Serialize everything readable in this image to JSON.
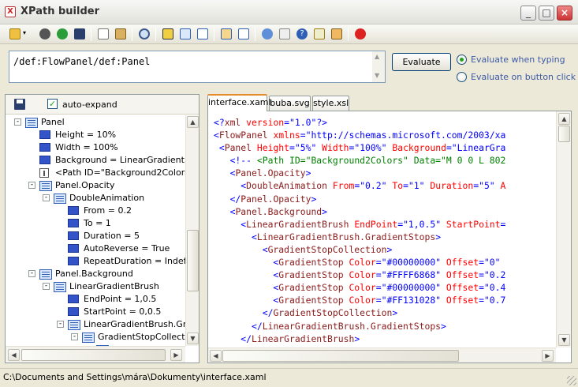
{
  "window": {
    "title": "XPath builder"
  },
  "xpath": {
    "value": "/def:FlowPanel/def:Panel"
  },
  "evaluate": {
    "button_label": "Evaluate",
    "radio_when_typing": "Evaluate when typing",
    "radio_on_button": "Evaluate on button click",
    "selected": "when_typing"
  },
  "tree_panel": {
    "auto_expand_label": "auto-expand",
    "auto_expand_checked": true,
    "nodes": [
      {
        "label": "Panel",
        "type": "element",
        "depth": 1,
        "expander": "-"
      },
      {
        "label": "Height = 10%",
        "type": "attribute",
        "depth": 2
      },
      {
        "label": "Width = 100%",
        "type": "attribute",
        "depth": 2
      },
      {
        "label": "Background = LinearGradient 0,0",
        "type": "attribute",
        "depth": 2
      },
      {
        "label": "<Path ID=\"Background2Colors\" D",
        "type": "comment",
        "depth": 2
      },
      {
        "label": "Panel.Opacity",
        "type": "element",
        "depth": 2,
        "expander": "-"
      },
      {
        "label": "DoubleAnimation",
        "type": "element",
        "depth": 3,
        "expander": "-"
      },
      {
        "label": "From = 0.2",
        "type": "attribute",
        "depth": 4
      },
      {
        "label": "To = 1",
        "type": "attribute",
        "depth": 4
      },
      {
        "label": "Duration = 5",
        "type": "attribute",
        "depth": 4
      },
      {
        "label": "AutoReverse = True",
        "type": "attribute",
        "depth": 4
      },
      {
        "label": "RepeatDuration = Indefinil",
        "type": "attribute",
        "depth": 4
      },
      {
        "label": "Panel.Background",
        "type": "element",
        "depth": 2,
        "expander": "-"
      },
      {
        "label": "LinearGradientBrush",
        "type": "element",
        "depth": 3,
        "expander": "-"
      },
      {
        "label": "EndPoint = 1,0.5",
        "type": "attribute",
        "depth": 4
      },
      {
        "label": "StartPoint = 0,0.5",
        "type": "attribute",
        "depth": 4
      },
      {
        "label": "LinearGradientBrush.Grad",
        "type": "element",
        "depth": 4,
        "expander": "-"
      },
      {
        "label": "GradientStopCollection",
        "type": "element",
        "depth": 5,
        "expander": "-"
      },
      {
        "label": "GradientSto",
        "type": "element",
        "depth": 6,
        "expander": "-"
      }
    ]
  },
  "tabs": [
    {
      "label": "interface.xaml",
      "active": true
    },
    {
      "label": "buba.svg",
      "active": false
    },
    {
      "label": "style.xsl",
      "active": false
    }
  ],
  "code_lines": [
    [
      [
        "br",
        "<?"
      ],
      [
        "el",
        "xml"
      ],
      [
        "at",
        " version"
      ],
      [
        "br",
        "="
      ],
      [
        "val",
        "\"1.0\""
      ],
      [
        "br",
        "?>"
      ]
    ],
    [
      [
        "br",
        "<"
      ],
      [
        "el",
        "FlowPanel"
      ],
      [
        "at",
        " xmlns"
      ],
      [
        "br",
        "="
      ],
      [
        "val",
        "\"http://schemas.microsoft.com/2003/xa"
      ]
    ],
    [
      [
        "br",
        " <"
      ],
      [
        "el",
        "Panel"
      ],
      [
        "at",
        " Height"
      ],
      [
        "br",
        "="
      ],
      [
        "val",
        "\"5%\""
      ],
      [
        "at",
        " Width"
      ],
      [
        "br",
        "="
      ],
      [
        "val",
        "\"100%\""
      ],
      [
        "at",
        " Background"
      ],
      [
        "br",
        "="
      ],
      [
        "val",
        "\"LinearGra"
      ]
    ],
    [
      [
        "br",
        "   <!-- "
      ],
      [
        "com",
        "<Path ID=\"Background2Colors\" Data=\"M 0 0 L 802"
      ]
    ],
    [
      [
        "br",
        "   <"
      ],
      [
        "el",
        "Panel.Opacity"
      ],
      [
        "br",
        ">"
      ]
    ],
    [
      [
        "br",
        "     <"
      ],
      [
        "el",
        "DoubleAnimation"
      ],
      [
        "at",
        " From"
      ],
      [
        "br",
        "="
      ],
      [
        "val",
        "\"0.2\""
      ],
      [
        "at",
        " To"
      ],
      [
        "br",
        "="
      ],
      [
        "val",
        "\"1\""
      ],
      [
        "at",
        " Duration"
      ],
      [
        "br",
        "="
      ],
      [
        "val",
        "\"5\""
      ],
      [
        "at",
        " A"
      ]
    ],
    [
      [
        "br",
        "   </"
      ],
      [
        "el",
        "Panel.Opacity"
      ],
      [
        "br",
        ">"
      ]
    ],
    [
      [
        "br",
        "   <"
      ],
      [
        "el",
        "Panel.Background"
      ],
      [
        "br",
        ">"
      ]
    ],
    [
      [
        "br",
        "     <"
      ],
      [
        "el",
        "LinearGradientBrush"
      ],
      [
        "at",
        " EndPoint"
      ],
      [
        "br",
        "="
      ],
      [
        "val",
        "\"1,0.5\""
      ],
      [
        "at",
        " StartPoint"
      ],
      [
        "br",
        "="
      ]
    ],
    [
      [
        "br",
        "       <"
      ],
      [
        "el",
        "LinearGradientBrush.GradientStops"
      ],
      [
        "br",
        ">"
      ]
    ],
    [
      [
        "br",
        "         <"
      ],
      [
        "el",
        "GradientStopCollection"
      ],
      [
        "br",
        ">"
      ]
    ],
    [
      [
        "br",
        "           <"
      ],
      [
        "el",
        "GradientStop"
      ],
      [
        "at",
        " Color"
      ],
      [
        "br",
        "="
      ],
      [
        "val",
        "\"#00000000\""
      ],
      [
        "at",
        " Offset"
      ],
      [
        "br",
        "="
      ],
      [
        "val",
        "\"0\""
      ]
    ],
    [
      [
        "br",
        "           <"
      ],
      [
        "el",
        "GradientStop"
      ],
      [
        "at",
        " Color"
      ],
      [
        "br",
        "="
      ],
      [
        "val",
        "\"#FFFF6868\""
      ],
      [
        "at",
        " Offset"
      ],
      [
        "br",
        "="
      ],
      [
        "val",
        "\"0.2"
      ]
    ],
    [
      [
        "br",
        "           <"
      ],
      [
        "el",
        "GradientStop"
      ],
      [
        "at",
        " Color"
      ],
      [
        "br",
        "="
      ],
      [
        "val",
        "\"#00000000\""
      ],
      [
        "at",
        " Offset"
      ],
      [
        "br",
        "="
      ],
      [
        "val",
        "\"0.4"
      ]
    ],
    [
      [
        "br",
        "           <"
      ],
      [
        "el",
        "GradientStop"
      ],
      [
        "at",
        " Color"
      ],
      [
        "br",
        "="
      ],
      [
        "val",
        "\"#FF131028\""
      ],
      [
        "at",
        " Offset"
      ],
      [
        "br",
        "="
      ],
      [
        "val",
        "\"0.7"
      ]
    ],
    [
      [
        "br",
        "         </"
      ],
      [
        "el",
        "GradientStopCollection"
      ],
      [
        "br",
        ">"
      ]
    ],
    [
      [
        "br",
        "       </"
      ],
      [
        "el",
        "LinearGradientBrush.GradientStops"
      ],
      [
        "br",
        ">"
      ]
    ],
    [
      [
        "br",
        "     </"
      ],
      [
        "el",
        "LinearGradientBrush"
      ],
      [
        "br",
        ">"
      ]
    ]
  ],
  "status": {
    "path": "C:\\Documents and Settings\\mára\\Dokumenty\\interface.xaml"
  },
  "toolbar_icons": [
    "open-icon",
    "stop-icon",
    "refresh-icon",
    "save-icon",
    "copy-icon",
    "paste-icon",
    "find-icon",
    "run-xpath-icon",
    "select-node-icon",
    "view-icon",
    "layout-icon",
    "list-icon",
    "namespace-icon",
    "tree-icon",
    "help-icon",
    "settings-icon",
    "exit-icon"
  ],
  "colors": {
    "accent": "#e68b2c",
    "xml_element": "#8b1a1a",
    "xml_attribute": "#ff0000",
    "xml_value": "#0000ff",
    "xml_comment": "#008000"
  }
}
